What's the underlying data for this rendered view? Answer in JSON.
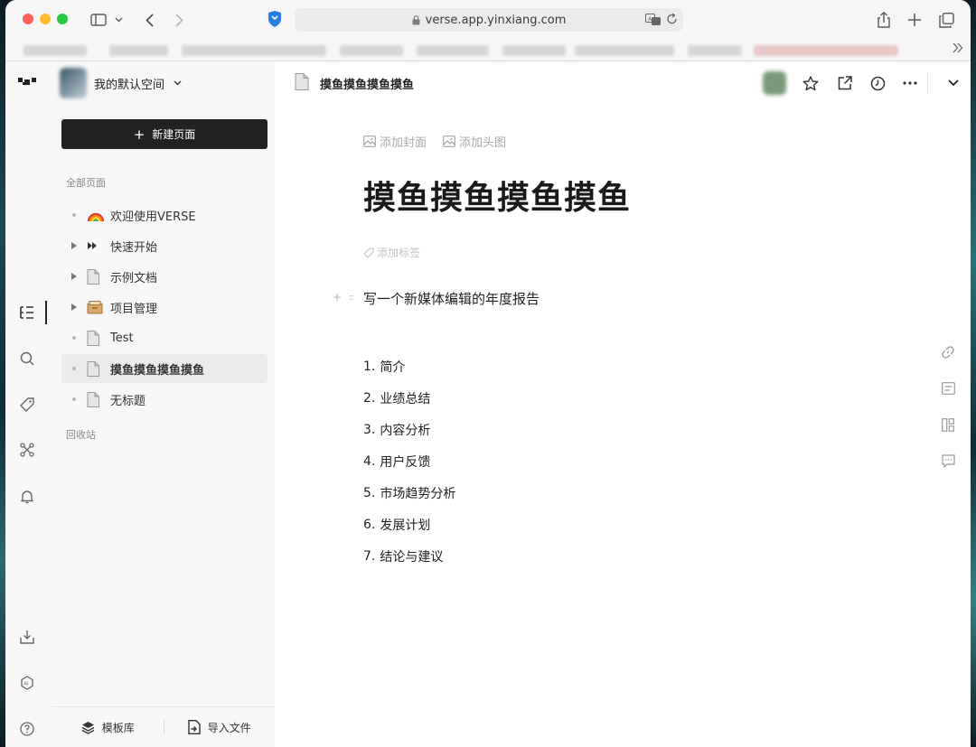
{
  "browser": {
    "url": "verse.app.yinxiang.com"
  },
  "workspace": {
    "name": "我的默认空间"
  },
  "sidebar": {
    "new_page_label": "新建页面",
    "all_pages_label": "全部页面",
    "trash_label": "回收站",
    "items": [
      {
        "label": "欢迎使用VERSE",
        "icon": "rainbow-emoji",
        "expandable": false,
        "active": false
      },
      {
        "label": "快速开始",
        "icon": "fast-forward-icon",
        "expandable": true,
        "active": false
      },
      {
        "label": "示例文档",
        "icon": "document-icon",
        "expandable": true,
        "active": false
      },
      {
        "label": "项目管理",
        "icon": "card-box-icon",
        "expandable": true,
        "active": false
      },
      {
        "label": "Test",
        "icon": "document-icon",
        "expandable": false,
        "active": false
      },
      {
        "label": "摸鱼摸鱼摸鱼摸鱼",
        "icon": "document-icon",
        "expandable": false,
        "active": true
      },
      {
        "label": "无标题",
        "icon": "document-icon",
        "expandable": false,
        "active": false
      }
    ],
    "footer": {
      "templates_label": "模板库",
      "import_label": "导入文件"
    }
  },
  "rail": {
    "icons": [
      "logo-icon",
      "outline-icon",
      "search-icon",
      "tag-icon",
      "graph-icon",
      "bell-icon",
      "download-icon",
      "ai-icon",
      "help-icon"
    ]
  },
  "document": {
    "title_small": "摸鱼摸鱼摸鱼摸鱼",
    "title": "摸鱼摸鱼摸鱼摸鱼",
    "add_cover_label": "添加封面",
    "add_icon_label": "添加头图",
    "add_tag_label": "添加标签",
    "paragraph": "写一个新媒体编辑的年度报告",
    "list": [
      {
        "num": "1.",
        "text": "简介"
      },
      {
        "num": "2.",
        "text": "业绩总结"
      },
      {
        "num": "3.",
        "text": "内容分析"
      },
      {
        "num": "4.",
        "text": "用户反馈"
      },
      {
        "num": "5.",
        "text": "市场趋势分析"
      },
      {
        "num": "6.",
        "text": "发展计划"
      },
      {
        "num": "7.",
        "text": "结论与建议"
      }
    ]
  }
}
